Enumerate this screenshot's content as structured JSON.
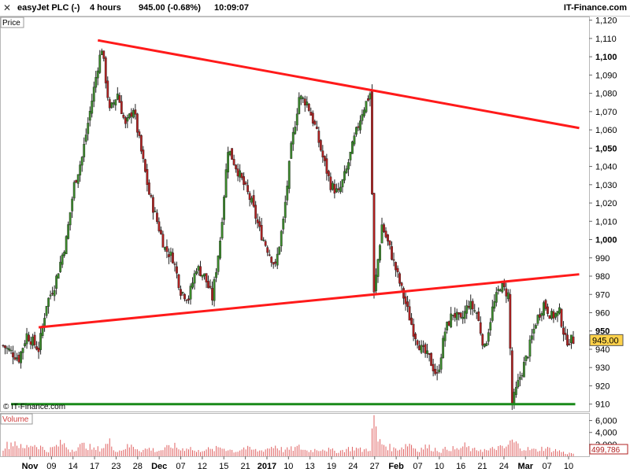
{
  "header": {
    "instrument": "easyJet PLC (-)",
    "interval": "4 hours",
    "quote": "945.00 (-0.68%)",
    "time": "10:09:07",
    "brand": "IT-Finance.com"
  },
  "panels": {
    "price_label": "Price",
    "volume_label": "Volume",
    "watermark": "© IT-Finance.com"
  },
  "colors": {
    "up": "#3a8a2a",
    "down": "#b02020",
    "trendline": "#ff1a1a",
    "support": "#1a8a1a",
    "volume": "#e06060",
    "last_price_bg": "#ffd24a"
  },
  "chart_data": {
    "type": "candlestick",
    "price_axis": {
      "ylim": [
        906,
        1122
      ],
      "ticks": [
        910,
        920,
        930,
        940,
        950,
        960,
        970,
        980,
        990,
        1000,
        1010,
        1020,
        1030,
        1040,
        1050,
        1060,
        1070,
        1080,
        1090,
        1100,
        1110,
        1120
      ],
      "tick_labels": [
        "910",
        "920",
        "930",
        "940",
        "950",
        "960",
        "970",
        "980",
        "990",
        "1,000",
        "1,010",
        "1,020",
        "1,030",
        "1,040",
        "1,050",
        "1,060",
        "1,070",
        "1,080",
        "1,090",
        "1,100",
        "1,110",
        "1,120"
      ],
      "bold_ticks": [
        950,
        1000,
        1050,
        1100
      ]
    },
    "last_price": "945.00",
    "volume_axis": {
      "ylim": [
        0,
        7000
      ],
      "ticks": [
        2000,
        4000,
        6000
      ],
      "tick_labels": [
        "2,000",
        "4,000",
        "6,000"
      ],
      "last_volume": "499,786"
    },
    "x_axis": {
      "labels": [
        "Nov",
        "09",
        "14",
        "17",
        "23",
        "28",
        "Dec",
        "07",
        "12",
        "15",
        "21",
        "2017",
        "10",
        "13",
        "19",
        "24",
        "27",
        "Feb",
        "07",
        "10",
        "16",
        "21",
        "24",
        "Mar",
        "07",
        "10"
      ],
      "bold_labels": [
        "Nov",
        "Dec",
        "2017",
        "Feb",
        "Mar"
      ]
    },
    "price_path": [
      [
        0,
        942
      ],
      [
        8,
        935
      ],
      [
        12,
        948
      ],
      [
        18,
        940
      ],
      [
        22,
        965
      ],
      [
        26,
        975
      ],
      [
        32,
        1000
      ],
      [
        36,
        1030
      ],
      [
        40,
        1045
      ],
      [
        44,
        1070
      ],
      [
        48,
        1095
      ],
      [
        50,
        1105
      ],
      [
        54,
        1070
      ],
      [
        58,
        1080
      ],
      [
        62,
        1062
      ],
      [
        66,
        1072
      ],
      [
        70,
        1048
      ],
      [
        74,
        1025
      ],
      [
        78,
        1010
      ],
      [
        82,
        995
      ],
      [
        86,
        990
      ],
      [
        90,
        972
      ],
      [
        94,
        968
      ],
      [
        98,
        985
      ],
      [
        102,
        980
      ],
      [
        106,
        968
      ],
      [
        110,
        1000
      ],
      [
        114,
        1050
      ],
      [
        118,
        1040
      ],
      [
        122,
        1030
      ],
      [
        126,
        1020
      ],
      [
        130,
        1005
      ],
      [
        134,
        995
      ],
      [
        138,
        985
      ],
      [
        142,
        1010
      ],
      [
        146,
        1050
      ],
      [
        150,
        1078
      ],
      [
        154,
        1075
      ],
      [
        158,
        1062
      ],
      [
        162,
        1045
      ],
      [
        166,
        1030
      ],
      [
        170,
        1025
      ],
      [
        174,
        1038
      ],
      [
        178,
        1055
      ],
      [
        182,
        1070
      ],
      [
        186,
        1080
      ],
      [
        188,
        970
      ],
      [
        192,
        1008
      ],
      [
        196,
        995
      ],
      [
        200,
        980
      ],
      [
        204,
        965
      ],
      [
        208,
        950
      ],
      [
        212,
        940
      ],
      [
        216,
        935
      ],
      [
        220,
        925
      ],
      [
        224,
        950
      ],
      [
        228,
        960
      ],
      [
        232,
        955
      ],
      [
        236,
        965
      ],
      [
        240,
        960
      ],
      [
        244,
        940
      ],
      [
        248,
        962
      ],
      [
        252,
        975
      ],
      [
        256,
        970
      ],
      [
        258,
        910
      ],
      [
        262,
        925
      ],
      [
        266,
        938
      ],
      [
        270,
        955
      ],
      [
        274,
        965
      ],
      [
        278,
        958
      ],
      [
        282,
        960
      ],
      [
        285,
        945
      ]
    ],
    "volume_path": [
      [
        0,
        1500
      ],
      [
        6,
        2500
      ],
      [
        10,
        1200
      ],
      [
        14,
        2000
      ],
      [
        18,
        1800
      ],
      [
        22,
        900
      ],
      [
        26,
        1500
      ],
      [
        30,
        2200
      ],
      [
        34,
        1000
      ],
      [
        38,
        1600
      ],
      [
        42,
        1900
      ],
      [
        46,
        1100
      ],
      [
        50,
        1400
      ],
      [
        54,
        2300
      ],
      [
        58,
        800
      ],
      [
        62,
        1500
      ],
      [
        66,
        1700
      ],
      [
        70,
        1000
      ],
      [
        74,
        1300
      ],
      [
        78,
        900
      ],
      [
        82,
        1200
      ],
      [
        86,
        1800
      ],
      [
        90,
        1100
      ],
      [
        94,
        1600
      ],
      [
        98,
        700
      ],
      [
        102,
        1300
      ],
      [
        106,
        1000
      ],
      [
        110,
        1500
      ],
      [
        114,
        1200
      ],
      [
        118,
        800
      ],
      [
        122,
        1400
      ],
      [
        126,
        1100
      ],
      [
        130,
        900
      ],
      [
        134,
        1300
      ],
      [
        138,
        1800
      ],
      [
        142,
        1000
      ],
      [
        146,
        1200
      ],
      [
        150,
        1500
      ],
      [
        154,
        900
      ],
      [
        158,
        1100
      ],
      [
        162,
        1300
      ],
      [
        166,
        1000
      ],
      [
        170,
        800
      ],
      [
        174,
        1200
      ],
      [
        178,
        1400
      ],
      [
        182,
        1000
      ],
      [
        186,
        1300
      ],
      [
        188,
        6800
      ],
      [
        190,
        2500
      ],
      [
        194,
        1800
      ],
      [
        198,
        1200
      ],
      [
        202,
        1500
      ],
      [
        206,
        2200
      ],
      [
        210,
        1000
      ],
      [
        214,
        1600
      ],
      [
        218,
        1300
      ],
      [
        222,
        900
      ],
      [
        226,
        1400
      ],
      [
        230,
        1100
      ],
      [
        234,
        1700
      ],
      [
        238,
        1000
      ],
      [
        242,
        1200
      ],
      [
        246,
        900
      ],
      [
        250,
        1500
      ],
      [
        254,
        1300
      ],
      [
        258,
        2500
      ],
      [
        262,
        1600
      ],
      [
        266,
        1200
      ],
      [
        270,
        1000
      ],
      [
        274,
        1400
      ],
      [
        278,
        1100
      ],
      [
        282,
        900
      ],
      [
        285,
        500
      ]
    ],
    "trendlines": [
      {
        "kind": "resistance",
        "x1": 48,
        "y1": 1109,
        "x2": 292,
        "y2": 1061
      },
      {
        "kind": "support",
        "x1": 18,
        "y1": 952,
        "x2": 292,
        "y2": 981
      },
      {
        "kind": "horizontal",
        "x1": 4,
        "y1": 910,
        "x2": 290,
        "y2": 910
      }
    ]
  }
}
